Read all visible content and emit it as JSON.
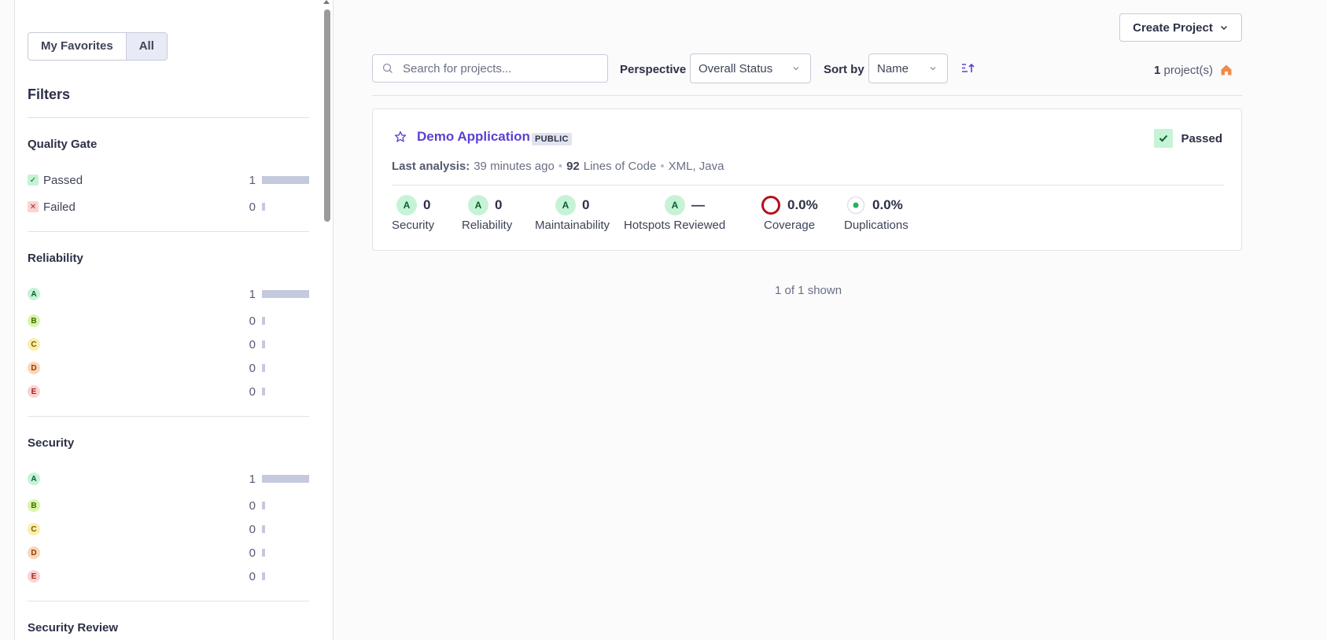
{
  "sidebar": {
    "favorites_toggle": {
      "my_favorites": "My Favorites",
      "all": "All",
      "selected": "All"
    },
    "filters_title": "Filters",
    "quality_gate": {
      "title": "Quality Gate",
      "items": [
        {
          "label": "Passed",
          "count": "1",
          "fraction": 1.0
        },
        {
          "label": "Failed",
          "count": "0",
          "fraction": 0.0
        }
      ]
    },
    "reliability": {
      "title": "Reliability",
      "items": [
        {
          "label": "A",
          "count": "1",
          "fraction": 1.0
        },
        {
          "label": "B",
          "count": "0",
          "fraction": 0.0
        },
        {
          "label": "C",
          "count": "0",
          "fraction": 0.0
        },
        {
          "label": "D",
          "count": "0",
          "fraction": 0.0
        },
        {
          "label": "E",
          "count": "0",
          "fraction": 0.0
        }
      ]
    },
    "security": {
      "title": "Security",
      "items": [
        {
          "label": "A",
          "count": "1",
          "fraction": 1.0
        },
        {
          "label": "B",
          "count": "0",
          "fraction": 0.0
        },
        {
          "label": "C",
          "count": "0",
          "fraction": 0.0
        },
        {
          "label": "D",
          "count": "0",
          "fraction": 0.0
        },
        {
          "label": "E",
          "count": "0",
          "fraction": 0.0
        }
      ]
    },
    "security_review": {
      "title": "Security Review"
    }
  },
  "toolbar": {
    "create_project": "Create Project",
    "search_placeholder": "Search for projects...",
    "perspective_label": "Perspective",
    "perspective_value": "Overall Status",
    "sort_label": "Sort by",
    "sort_value": "Name",
    "project_count": "1",
    "project_count_suffix": "project(s)"
  },
  "project": {
    "name": "Demo Application",
    "visibility": "PUBLIC",
    "status": "Passed",
    "last_analysis_label": "Last analysis:",
    "last_analysis_value": "39 minutes ago",
    "lines_count": "92",
    "lines_label": "Lines of Code",
    "languages": "XML, Java",
    "metrics": [
      {
        "label": "Security",
        "rating": "A",
        "value": "0"
      },
      {
        "label": "Reliability",
        "rating": "A",
        "value": "0"
      },
      {
        "label": "Maintainability",
        "rating": "A",
        "value": "0"
      },
      {
        "label": "Hotspots Reviewed",
        "rating": "A",
        "value": "—"
      },
      {
        "label": "Coverage",
        "value": "0.0%"
      },
      {
        "label": "Duplications",
        "value": "0.0%"
      }
    ]
  },
  "footer": {
    "shown": "1 of 1 shown"
  },
  "colors": {
    "accent": "#5d3fd3",
    "passed_bg": "#c6f3d6",
    "coverage_ring": "#b3111d",
    "duplication_dot": "#21b35d",
    "home_icon": "#f08b4a"
  }
}
